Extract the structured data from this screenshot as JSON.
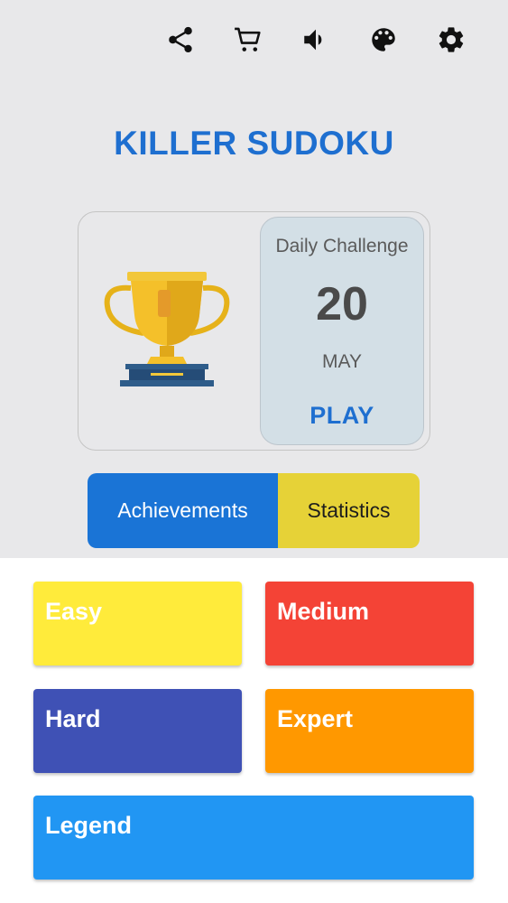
{
  "toolbar": {
    "icons": [
      "share-icon",
      "cart-icon",
      "volume-icon",
      "palette-icon",
      "settings-icon"
    ]
  },
  "app_title": "KILLER SUDOKU",
  "daily_challenge": {
    "label": "Daily Challenge",
    "day": "20",
    "month": "MAY",
    "play_label": "PLAY"
  },
  "tabs": {
    "achievements": "Achievements",
    "statistics": "Statistics"
  },
  "levels": {
    "easy": "Easy",
    "medium": "Medium",
    "hard": "Hard",
    "expert": "Expert",
    "legend": "Legend"
  },
  "colors": {
    "accent_blue": "#1e6fd0",
    "easy": "#ffeb3b",
    "medium": "#f44336",
    "hard": "#3f51b5",
    "expert": "#ff9800",
    "legend": "#2196f3",
    "statistics_tab": "#e6d237"
  }
}
